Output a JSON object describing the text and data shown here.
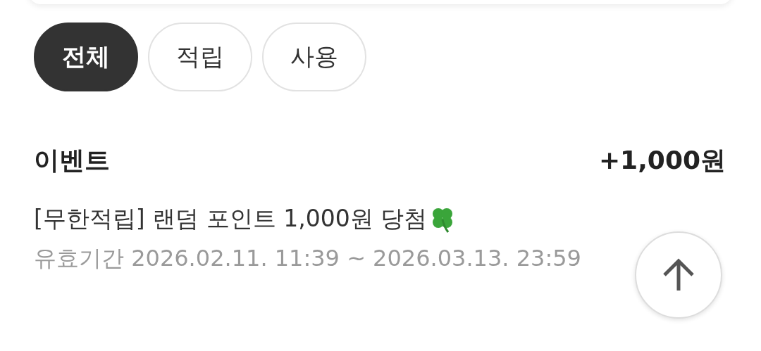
{
  "tabs": [
    {
      "label": "전체",
      "selected": true
    },
    {
      "label": "적립",
      "selected": false
    },
    {
      "label": "사용",
      "selected": false
    }
  ],
  "history": [
    {
      "category": "이벤트",
      "amount": "+1,000원",
      "description": "[무한적립] 랜덤 포인트 1,000원 당첨",
      "validity": "유효기간 2026.02.11. 11:39 ~ 2026.03.13. 23:59"
    }
  ]
}
